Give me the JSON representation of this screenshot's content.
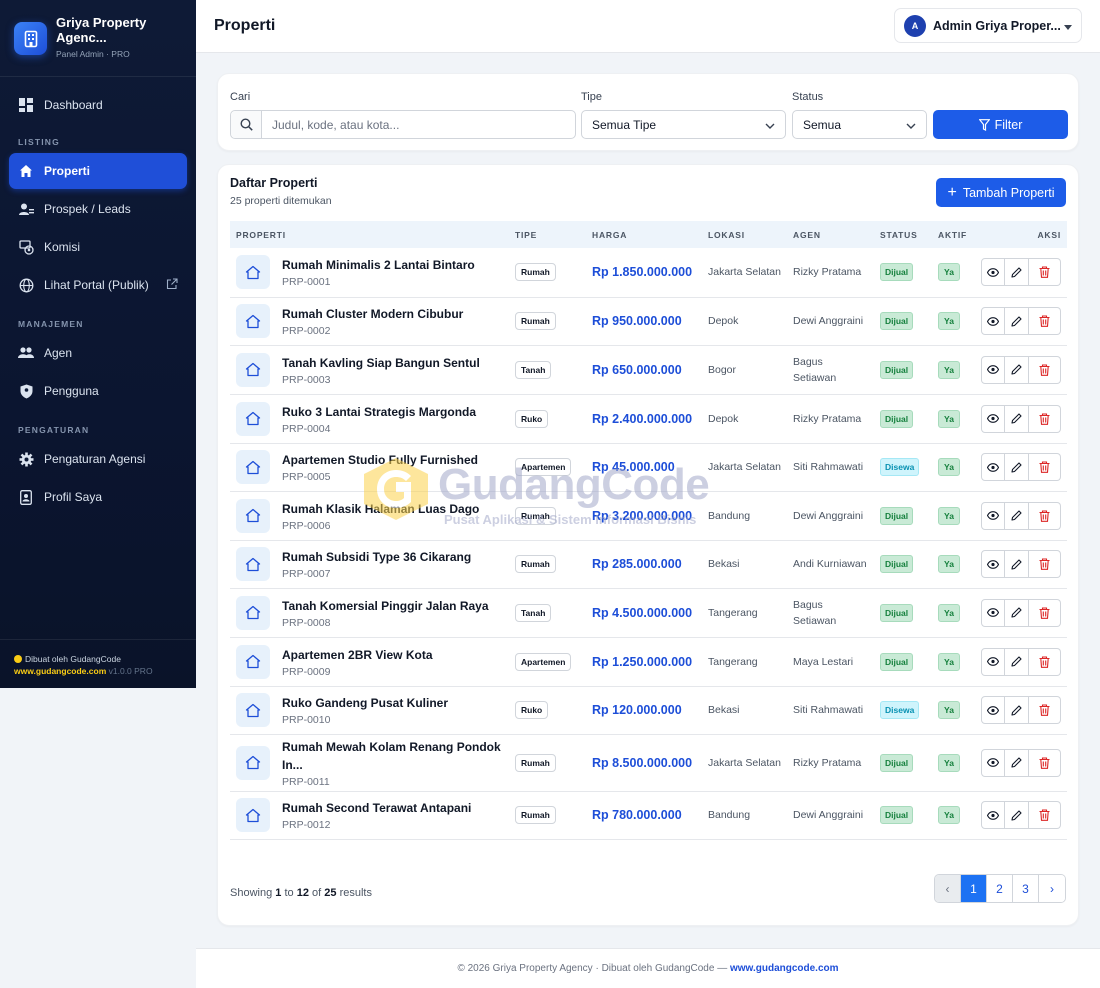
{
  "brand": {
    "name": "Griya Property Agenc...",
    "sub": "Panel Admin · PRO"
  },
  "sidebar": {
    "items": [
      {
        "label": "Dashboard"
      },
      {
        "label": "Properti"
      },
      {
        "label": "Prospek / Leads"
      },
      {
        "label": "Komisi"
      },
      {
        "label": "Lihat Portal (Publik)"
      },
      {
        "label": "Agen"
      },
      {
        "label": "Pengguna"
      },
      {
        "label": "Pengaturan Agensi"
      },
      {
        "label": "Profil Saya"
      }
    ],
    "sections": {
      "listing": "LISTING",
      "manajemen": "MANAJEMEN",
      "pengaturan": "PENGATURAN"
    },
    "footer": {
      "made_by": "Dibuat oleh GudangCode",
      "link": "www.gudangcode.com",
      "version": "v1.0.0 PRO"
    }
  },
  "header": {
    "title": "Properti",
    "user_initial": "A",
    "user_name": "Admin Griya Proper..."
  },
  "filter": {
    "search_label": "Cari",
    "search_placeholder": "Judul, kode, atau kota...",
    "type_label": "Tipe",
    "type_value": "Semua Tipe",
    "status_label": "Status",
    "status_value": "Semua",
    "button": "Filter"
  },
  "list": {
    "title": "Daftar Properti",
    "count": "25 properti ditemukan",
    "add_button": "Tambah Properti",
    "columns": [
      "PROPERTI",
      "TIPE",
      "HARGA",
      "LOKASI",
      "AGEN",
      "STATUS",
      "AKTIF",
      "AKSI"
    ],
    "rows": [
      {
        "title": "Rumah Minimalis 2 Lantai Bintaro",
        "code": "PRP-0001",
        "type": "Rumah",
        "price": "Rp 1.850.000.000",
        "location": "Jakarta Selatan",
        "agent": "Rizky Pratama",
        "status": "Dijual",
        "active": "Ya"
      },
      {
        "title": "Rumah Cluster Modern Cibubur",
        "code": "PRP-0002",
        "type": "Rumah",
        "price": "Rp 950.000.000",
        "location": "Depok",
        "agent": "Dewi Anggraini",
        "status": "Dijual",
        "active": "Ya"
      },
      {
        "title": "Tanah Kavling Siap Bangun Sentul",
        "code": "PRP-0003",
        "type": "Tanah",
        "price": "Rp 650.000.000",
        "location": "Bogor",
        "agent": "Bagus Setiawan",
        "status": "Dijual",
        "active": "Ya"
      },
      {
        "title": "Ruko 3 Lantai Strategis Margonda",
        "code": "PRP-0004",
        "type": "Ruko",
        "price": "Rp 2.400.000.000",
        "location": "Depok",
        "agent": "Rizky Pratama",
        "status": "Dijual",
        "active": "Ya"
      },
      {
        "title": "Apartemen Studio Fully Furnished",
        "code": "PRP-0005",
        "type": "Apartemen",
        "price": "Rp 45.000.000",
        "location": "Jakarta Selatan",
        "agent": "Siti Rahmawati",
        "status": "Disewa",
        "active": "Ya"
      },
      {
        "title": "Rumah Klasik Halaman Luas Dago",
        "code": "PRP-0006",
        "type": "Rumah",
        "price": "Rp 3.200.000.000",
        "location": "Bandung",
        "agent": "Dewi Anggraini",
        "status": "Dijual",
        "active": "Ya"
      },
      {
        "title": "Rumah Subsidi Type 36 Cikarang",
        "code": "PRP-0007",
        "type": "Rumah",
        "price": "Rp 285.000.000",
        "location": "Bekasi",
        "agent": "Andi Kurniawan",
        "status": "Dijual",
        "active": "Ya"
      },
      {
        "title": "Tanah Komersial Pinggir Jalan Raya",
        "code": "PRP-0008",
        "type": "Tanah",
        "price": "Rp 4.500.000.000",
        "location": "Tangerang",
        "agent": "Bagus Setiawan",
        "status": "Dijual",
        "active": "Ya"
      },
      {
        "title": "Apartemen 2BR View Kota",
        "code": "PRP-0009",
        "type": "Apartemen",
        "price": "Rp 1.250.000.000",
        "location": "Tangerang",
        "agent": "Maya Lestari",
        "status": "Dijual",
        "active": "Ya"
      },
      {
        "title": "Ruko Gandeng Pusat Kuliner",
        "code": "PRP-0010",
        "type": "Ruko",
        "price": "Rp 120.000.000",
        "location": "Bekasi",
        "agent": "Siti Rahmawati",
        "status": "Disewa",
        "active": "Ya"
      },
      {
        "title": "Rumah Mewah Kolam Renang Pondok In...",
        "code": "PRP-0011",
        "type": "Rumah",
        "price": "Rp 8.500.000.000",
        "location": "Jakarta Selatan",
        "agent": "Rizky Pratama",
        "status": "Dijual",
        "active": "Ya"
      },
      {
        "title": "Rumah Second Terawat Antapani",
        "code": "PRP-0012",
        "type": "Rumah",
        "price": "Rp 780.000.000",
        "location": "Bandung",
        "agent": "Dewi Anggraini",
        "status": "Dijual",
        "active": "Ya"
      }
    ]
  },
  "pagination": {
    "showing_prefix": "Showing",
    "from": "1",
    "to_word": "to",
    "to": "12",
    "of_word": "of",
    "total": "25",
    "suffix": "results",
    "prev": "‹",
    "pages": [
      "1",
      "2",
      "3"
    ],
    "next": "›",
    "current": "1"
  },
  "footer": {
    "text": "© 2026 Griya Property Agency · Dibuat oleh GudangCode — ",
    "link": "www.gudangcode.com"
  },
  "watermark": {
    "text": "GudangCode",
    "sub": "Pusat Aplikasi & Sistem Informasi Bisnis"
  },
  "colors": {
    "primary": "#1d5ce8",
    "sidebar": "#0e1a36",
    "active_nav": "#1f4fd8",
    "price": "#1d4ed8",
    "dijual_bg": "#c9ead6",
    "disewa_bg": "#cff4fc",
    "delete": "#dc2626"
  }
}
